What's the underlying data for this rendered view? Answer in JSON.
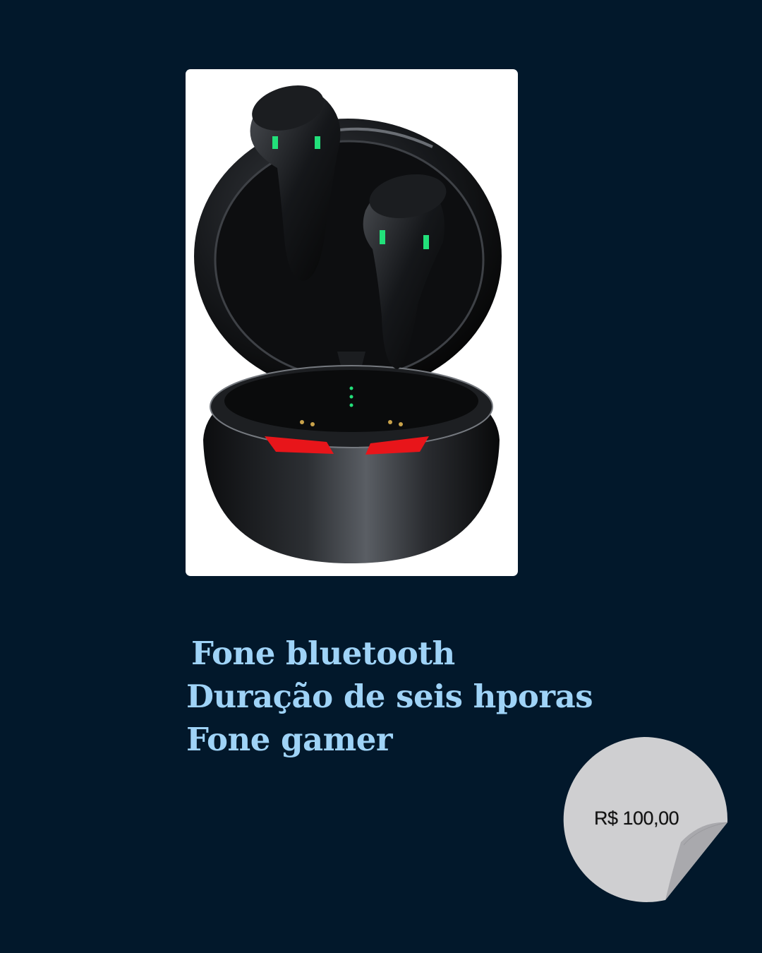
{
  "product": {
    "image_alt": "fone-bluetooth-gamer",
    "description_lines": [
      "Fone bluetooth",
      "Duração de seis hporas",
      "Fone gamer"
    ]
  },
  "price": {
    "label": "R$ 100,00"
  },
  "colors": {
    "background": "#02182b",
    "text": "#9fd3f7",
    "sticker": "#cfcfd1",
    "led_green": "#22e07a",
    "led_red": "#e8151a"
  }
}
